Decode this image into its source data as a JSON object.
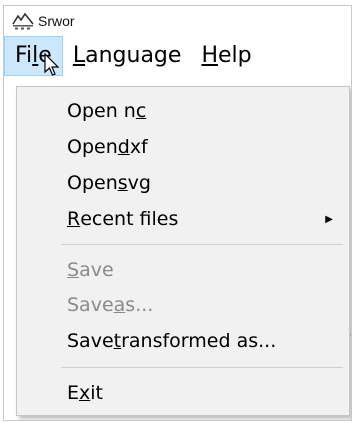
{
  "window": {
    "title": "Srwor",
    "icon": "app-logo-icon"
  },
  "menubar": [
    {
      "pre": "Fi",
      "ul": "l",
      "post": "e",
      "active": true
    },
    {
      "pre": "",
      "ul": "L",
      "post": "anguage",
      "active": false
    },
    {
      "pre": "",
      "ul": "H",
      "post": "elp",
      "active": false
    }
  ],
  "file_menu": {
    "items": [
      {
        "pre": "Open n",
        "ul": "c",
        "post": "",
        "enabled": true
      },
      {
        "pre": "Open ",
        "ul": "d",
        "post": "xf",
        "enabled": true
      },
      {
        "pre": "Open ",
        "ul": "s",
        "post": "vg",
        "enabled": true
      },
      {
        "pre": "",
        "ul": "R",
        "post": "ecent files",
        "enabled": true,
        "submenu": true,
        "submenu_icon": "submenu-arrow-icon"
      },
      {
        "pre": "",
        "ul": "S",
        "post": "ave",
        "enabled": false
      },
      {
        "pre": "Save ",
        "ul": "a",
        "post": "s...",
        "enabled": false
      },
      {
        "pre": "Save ",
        "ul": "t",
        "post": "ransformed as...",
        "enabled": true
      },
      {
        "pre": "E",
        "ul": "x",
        "post": "it",
        "enabled": true
      }
    ]
  },
  "colors": {
    "menu_highlight": "#cce8ff",
    "menu_highlight_border": "#99d1ff",
    "disabled_text": "#8a8a8a",
    "menu_background": "#f1f1f1"
  }
}
